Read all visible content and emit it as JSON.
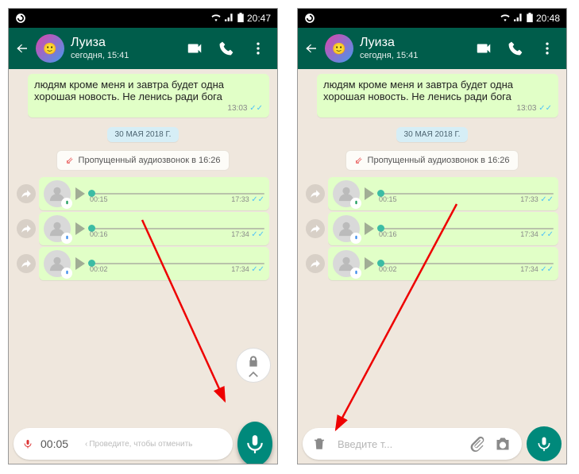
{
  "left": {
    "status_time": "20:47",
    "contact_name": "Луиза",
    "contact_sub": "сегодня, 15:41",
    "msg_text": "людям кроме меня и завтра будет одна хорошая новость. Не ленись ради бога",
    "msg_time": "13:03",
    "date_chip": "30 МАЯ 2018 Г.",
    "missed_label": "Пропущенный аудиозвонок в 16:26",
    "voices": [
      {
        "dur": "00:15",
        "time": "17:33",
        "mic": "green"
      },
      {
        "dur": "00:16",
        "time": "17:34",
        "mic": "blue"
      },
      {
        "dur": "00:02",
        "time": "17:34",
        "mic": "blue"
      }
    ],
    "rec_time": "00:05",
    "swipe_hint": "Проведите, чтобы отменить"
  },
  "right": {
    "status_time": "20:48",
    "contact_name": "Луиза",
    "contact_sub": "сегодня, 15:41",
    "msg_text": "людям кроме меня и завтра будет одна хорошая новость. Не ленись ради бога",
    "msg_time": "13:03",
    "date_chip": "30 МАЯ 2018 Г.",
    "missed_label": "Пропущенный аудиозвонок в 16:26",
    "voices": [
      {
        "dur": "00:15",
        "time": "17:33",
        "mic": "green"
      },
      {
        "dur": "00:16",
        "time": "17:34",
        "mic": "blue"
      },
      {
        "dur": "00:02",
        "time": "17:34",
        "mic": "blue"
      }
    ],
    "placeholder": "Введите т..."
  }
}
